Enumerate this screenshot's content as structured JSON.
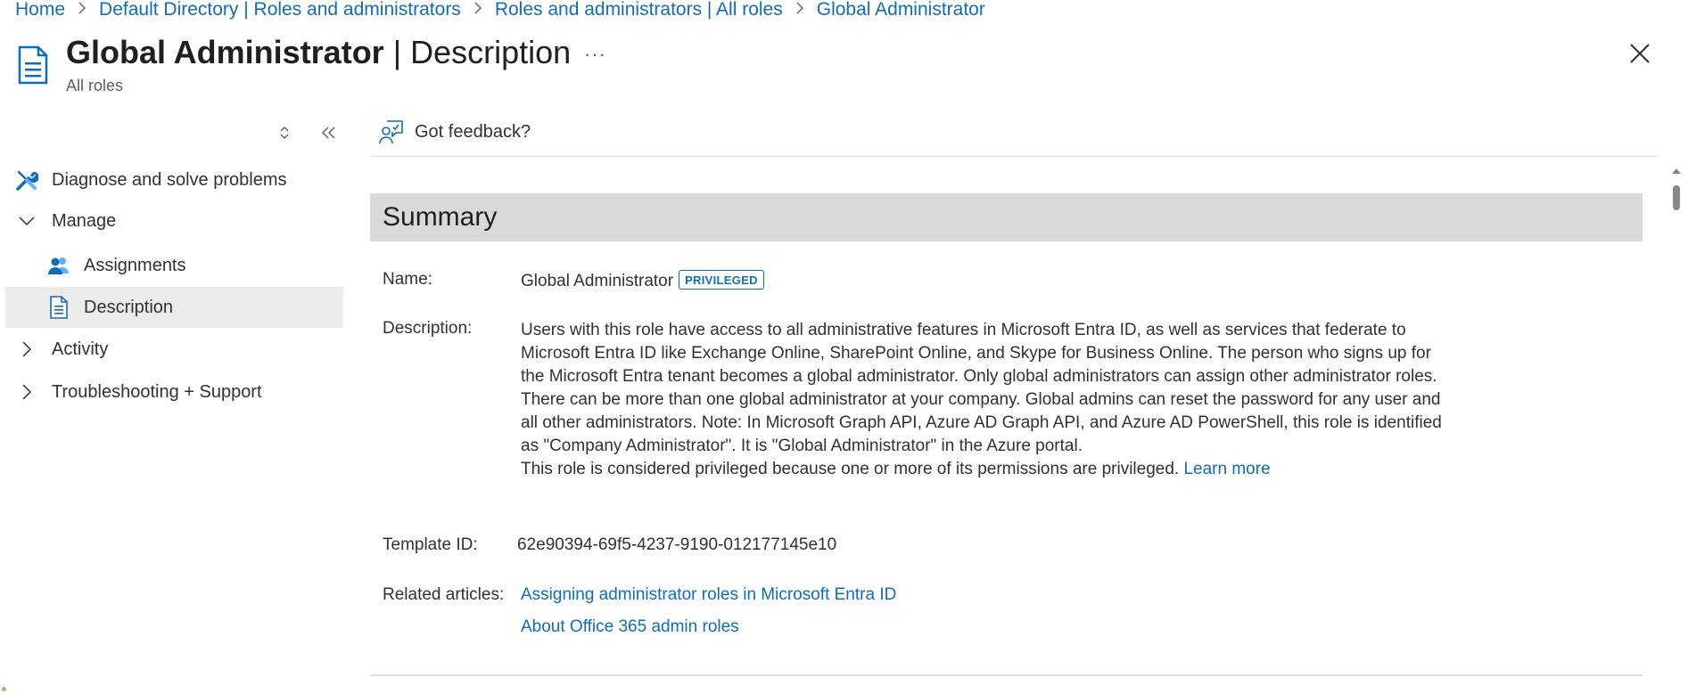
{
  "breadcrumb": {
    "items": [
      "Home",
      "Default Directory | Roles and administrators",
      "Roles and administrators | All roles",
      "Global Administrator"
    ]
  },
  "header": {
    "title_bold": "Global Administrator",
    "title_sep": " | ",
    "title_light": "Description",
    "subtitle": "All roles",
    "more_label": "···"
  },
  "sidebar": {
    "items": [
      {
        "label": "Diagnose and solve problems",
        "icon": "wrench-icon"
      },
      {
        "label": "Manage",
        "icon": "chevron-down-icon",
        "expanded": true
      },
      {
        "label": "Assignments",
        "icon": "users-icon"
      },
      {
        "label": "Description",
        "icon": "document-icon",
        "selected": true
      },
      {
        "label": "Activity",
        "icon": "chevron-right-icon"
      },
      {
        "label": "Troubleshooting + Support",
        "icon": "chevron-right-icon"
      }
    ]
  },
  "toolbar": {
    "feedback_label": "Got feedback?"
  },
  "summary": {
    "heading": "Summary",
    "name_label": "Name:",
    "name_value": "Global Administrator",
    "badge": "PRIVILEGED",
    "description_label": "Description:",
    "description_text": "Users with this role have access to all administrative features in Microsoft Entra ID, as well as services that federate to Microsoft Entra ID like Exchange Online, SharePoint Online, and Skype for Business Online. The person who signs up for the Microsoft Entra tenant becomes a global administrator. Only global administrators can assign other administrator roles. There can be more than one global administrator at your company. Global admins can reset the password for any user and all other administrators. Note: In Microsoft Graph API, Azure AD Graph API, and Azure AD PowerShell, this role is identified as \"Company Administrator\". It is \"Global Administrator\" in the Azure portal.",
    "privileged_note": "This role is considered privileged because one or more of its permissions are privileged.",
    "learn_more": "Learn more",
    "template_label": "Template ID:",
    "template_value": "62e90394-69f5-4237-9190-012177145e10",
    "related_label": "Related articles:",
    "related_links": [
      "Assigning administrator roles in Microsoft Entra ID",
      "About Office 365 admin roles"
    ]
  },
  "colors": {
    "link": "#0f6cbd",
    "selected_bg": "#edebe9",
    "summary_bg": "#d9d9d9"
  }
}
